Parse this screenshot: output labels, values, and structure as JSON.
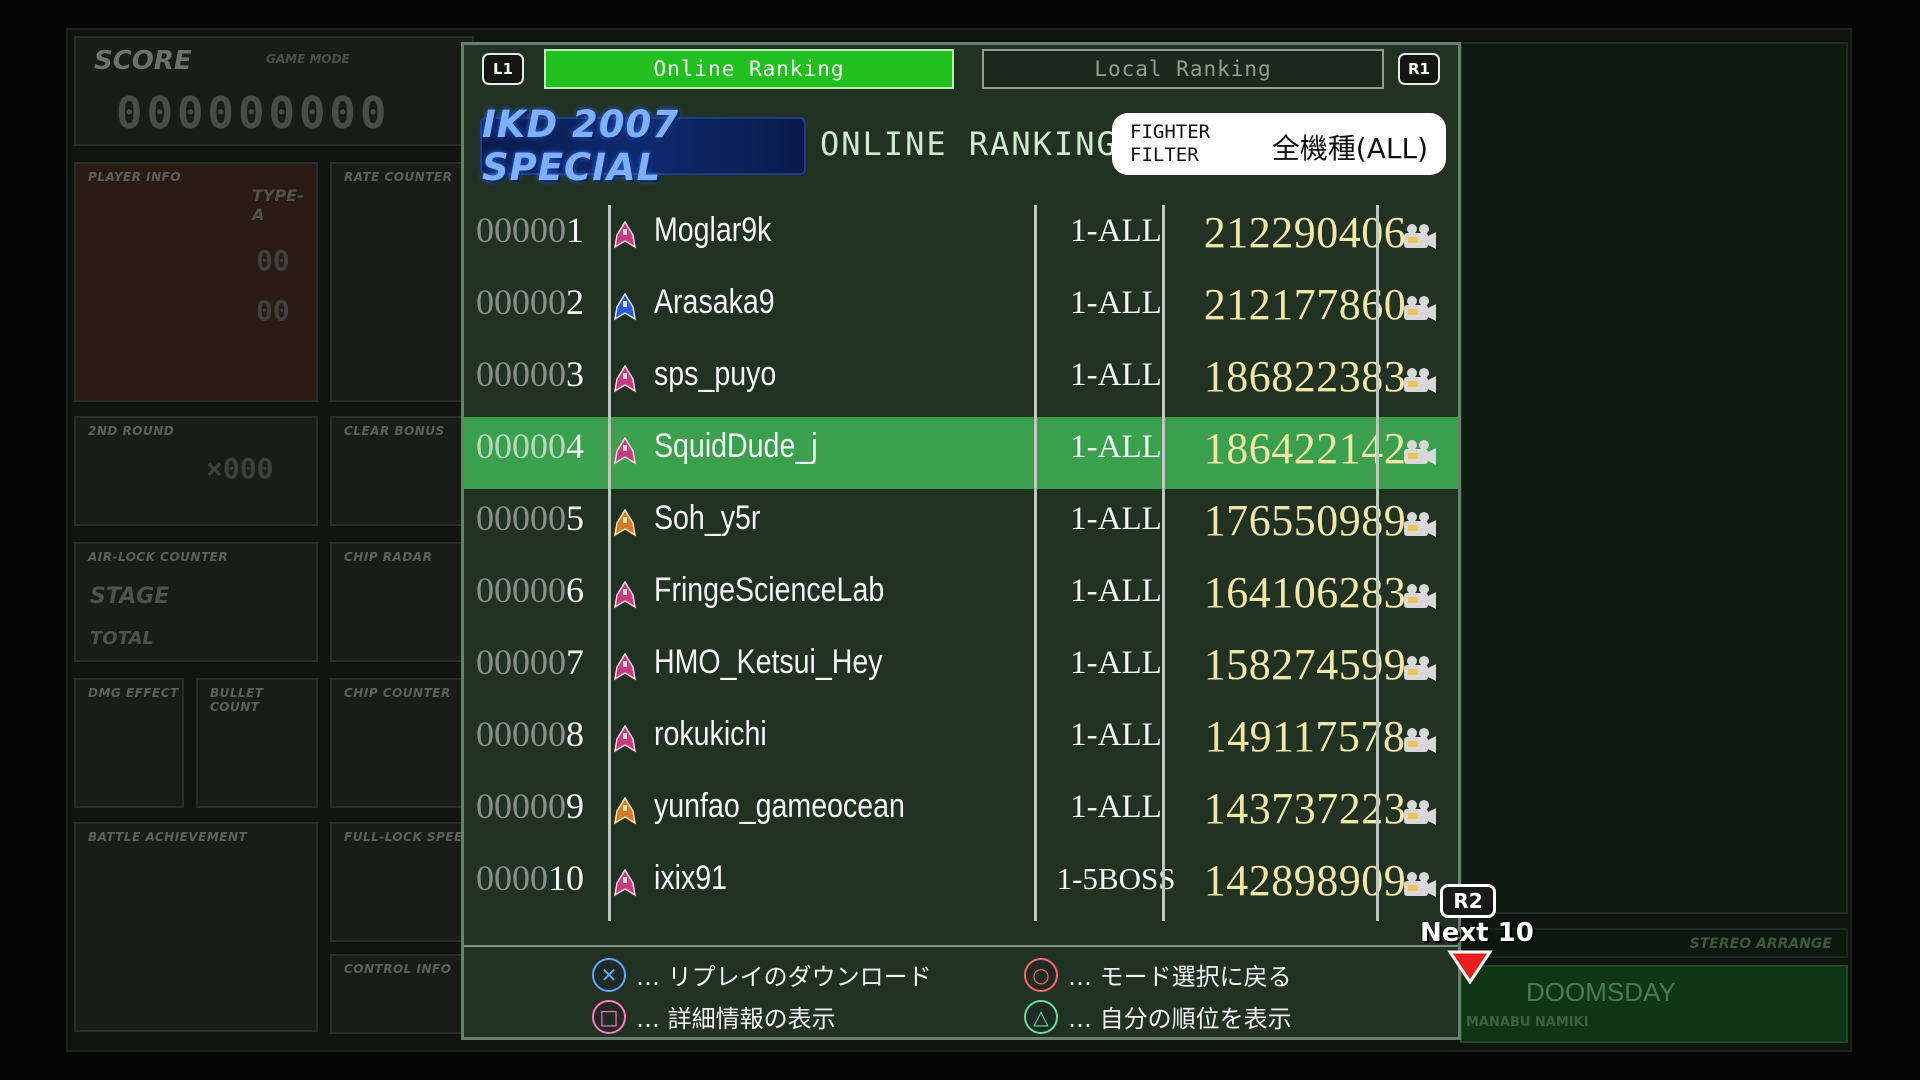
{
  "hud": {
    "score_title": "SCORE",
    "game_mode_label": "GAME MODE",
    "score_digits": "000000000",
    "player_info": "PLAYER INFO",
    "type": "TYPE-A",
    "rate_counter": "RATE COUNTER",
    "second_round": "2ND ROUND",
    "clear_bonus": "CLEAR BONUS",
    "air_lock_counter": "AIR-LOCK COUNTER",
    "chip_radar": "CHIP RADAR",
    "stage_label": "STAGE",
    "total_label": "TOTAL",
    "dmg_effect": "DMG EFFECT",
    "bullet_count": "BULLET COUNT",
    "chip_counter": "CHIP COUNTER",
    "battle_achievement": "BATTLE ACHIEVEMENT",
    "full_lock_speed": "FULL-LOCK SPEED",
    "control_info": "CONTROL INFO",
    "stereo_arrange": "STEREO ARRANGE",
    "track_title": "DOOMSDAY",
    "composer": "MANABU NAMIKI"
  },
  "tabs": {
    "l1": "L1",
    "r1": "R1",
    "online": "Online Ranking",
    "local": "Local Ranking"
  },
  "header": {
    "game_title": "IKD 2007 SPECIAL",
    "section_title": "ONLINE RANKING",
    "filter_label": "FIGHTER FILTER",
    "filter_value": "全機種(ALL)"
  },
  "ranking": [
    {
      "zeros": "00000",
      "num": "1",
      "player": "Moglar9k",
      "stage": "1-ALL",
      "score": "212290406",
      "ship": "red"
    },
    {
      "zeros": "00000",
      "num": "2",
      "player": "Arasaka9",
      "stage": "1-ALL",
      "score": "212177860",
      "ship": "blue"
    },
    {
      "zeros": "00000",
      "num": "3",
      "player": "sps_puyo",
      "stage": "1-ALL",
      "score": "186822383",
      "ship": "red"
    },
    {
      "zeros": "00000",
      "num": "4",
      "player": "SquidDude_j",
      "stage": "1-ALL",
      "score": "186422142",
      "ship": "red"
    },
    {
      "zeros": "00000",
      "num": "5",
      "player": "Soh_y5r",
      "stage": "1-ALL",
      "score": "176550989",
      "ship": "gold"
    },
    {
      "zeros": "00000",
      "num": "6",
      "player": "FringeScienceLab",
      "stage": "1-ALL",
      "score": "164106283",
      "ship": "red"
    },
    {
      "zeros": "00000",
      "num": "7",
      "player": "HMO_Ketsui_Hey",
      "stage": "1-ALL",
      "score": "158274599",
      "ship": "red"
    },
    {
      "zeros": "00000",
      "num": "8",
      "player": "rokukichi",
      "stage": "1-ALL",
      "score": "149117578",
      "ship": "red"
    },
    {
      "zeros": "00000",
      "num": "9",
      "player": "yunfao_gameocean",
      "stage": "1-ALL",
      "score": "143737223",
      "ship": "gold"
    },
    {
      "zeros": "0000",
      "num": "10",
      "player": "ixix91",
      "stage": "1-5BOSS",
      "score": "142898909",
      "ship": "red"
    }
  ],
  "highlighted_rank": 4,
  "legend": {
    "cross": "… リプレイのダウンロード",
    "square": "… 詳細情報の表示",
    "circle": "… モード選択に戻る",
    "triangle": "… 自分の順位を表示"
  },
  "next": {
    "r2": "R2",
    "label": "Next 10"
  },
  "colors": {
    "online_tab": "#22c01f",
    "highlight_row": "#3aa04d",
    "score_text": "#f0e6a6",
    "panel_bg": "#213223"
  }
}
